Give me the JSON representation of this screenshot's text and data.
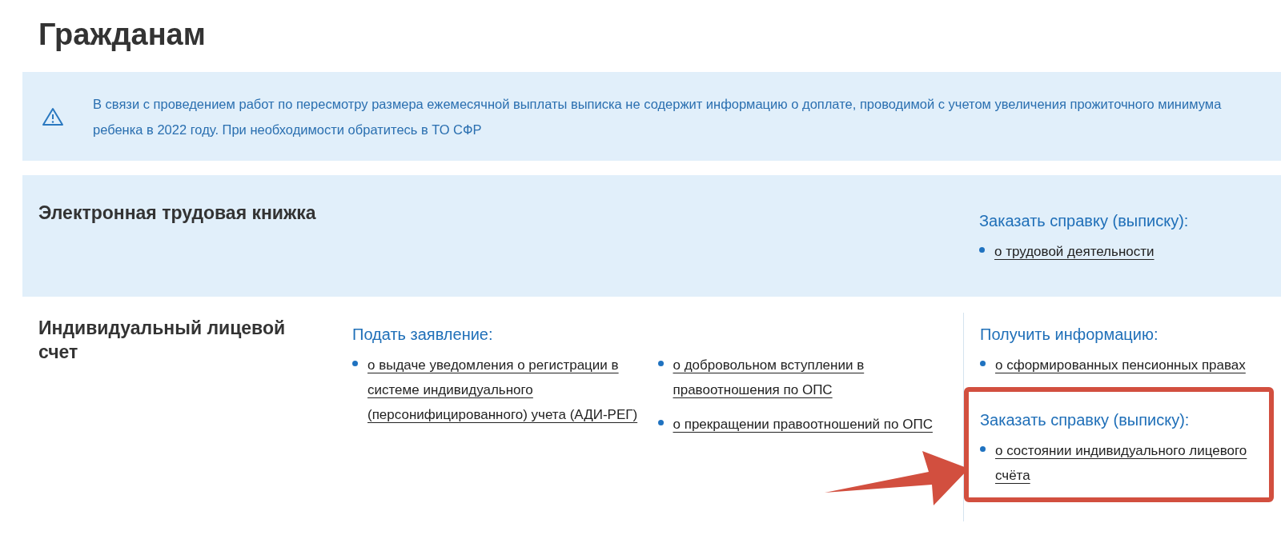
{
  "page_title": "Гражданам",
  "notice": {
    "text": "В связи с проведением работ по пересмотру размера ежемесячной выплаты выписка не содержит информацию о доплате, проводимой с учетом увеличения прожиточного минимума ребенка в 2022 году. При необходимости обратитесь в ТО СФР"
  },
  "sections": [
    {
      "title": "Электронная трудовая книжка",
      "shaded": true,
      "aside": {
        "groups": [
          {
            "heading": "Заказать справку (выписку):",
            "highlighted": false,
            "links": [
              "о трудовой деятельности"
            ]
          }
        ]
      }
    },
    {
      "title": "Индивидуальный лицевой счет",
      "shaded": false,
      "main": {
        "heading": "Подать заявление:",
        "columns": [
          [
            "о выдаче уведомления о регистрации в системе индивидуального (персонифицированного) учета (АДИ-РЕГ)"
          ],
          [
            "о добровольном вступлении в правоотношения по ОПС",
            "о прекращении правоотношений по ОПС"
          ]
        ]
      },
      "aside": {
        "groups": [
          {
            "heading": "Получить информацию:",
            "highlighted": false,
            "links": [
              "о сформированных пенсионных правах"
            ]
          },
          {
            "heading": "Заказать справку (выписку):",
            "highlighted": true,
            "links": [
              "о состоянии индивидуального лицевого счёта"
            ]
          }
        ]
      }
    }
  ]
}
